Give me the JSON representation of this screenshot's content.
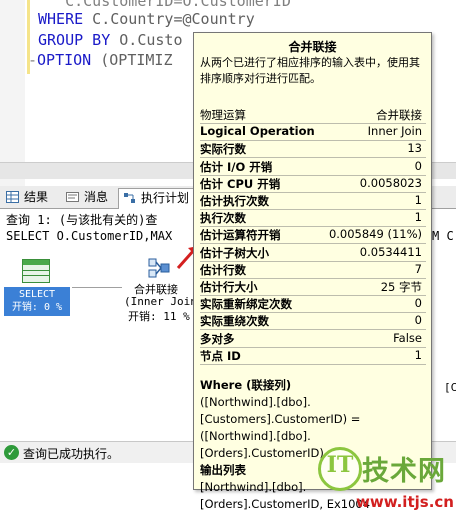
{
  "editor": {
    "lines": [
      {
        "kw": "WHERE",
        "rest": " C.Country=@Country"
      },
      {
        "kw": "GROUP BY",
        "rest": " O.Custo"
      },
      {
        "kw": "OPTION",
        "rest": " (OPTIMIZ"
      }
    ]
  },
  "tabs": [
    {
      "label": "结果"
    },
    {
      "label": "消息"
    },
    {
      "label": "执行计划"
    }
  ],
  "plan": {
    "query_header": "查询 1: (与该批有关的)查",
    "query_text": "SELECT O.CustomerID,MAX",
    "query_text_right": "M C",
    "select_node": {
      "label": "SELECT",
      "cost": "开销: 0 %"
    },
    "merge_node": {
      "label": "合并联接",
      "sub": "(Inner Join",
      "cost": "开销: 11 %"
    },
    "right_fragment": "[C"
  },
  "tooltip": {
    "title": "合并联接",
    "description": "从两个已进行了相应排序的输入表中，使用其排序顺序对行进行匹配。",
    "rows": [
      {
        "key": "物理运算",
        "value": "合并联接",
        "bold": false
      },
      {
        "key": "Logical Operation",
        "value": "Inner Join",
        "bold": true
      },
      {
        "key": "实际行数",
        "value": "13",
        "bold": true
      },
      {
        "key": "估计 I/O 开销",
        "value": "0",
        "bold": true
      },
      {
        "key": "估计 CPU 开销",
        "value": "0.0058023",
        "bold": true
      },
      {
        "key": "估计执行次数",
        "value": "1",
        "bold": true
      },
      {
        "key": "执行次数",
        "value": "1",
        "bold": true
      },
      {
        "key": "估计运算符开销",
        "value": "0.005849 (11%)",
        "bold": true
      },
      {
        "key": "估计子树大小",
        "value": "0.0534411",
        "bold": true
      },
      {
        "key": "估计行数",
        "value": "7",
        "bold": true
      },
      {
        "key": "估计行大小",
        "value": "25 字节",
        "bold": true
      },
      {
        "key": "实际重新绑定次数",
        "value": "0",
        "bold": true
      },
      {
        "key": "实际重绕次数",
        "value": "0",
        "bold": true
      },
      {
        "key": "多对多",
        "value": "False",
        "bold": true
      },
      {
        "key": "节点 ID",
        "value": "1",
        "bold": true
      }
    ],
    "where_title": "Where (联接列)",
    "where_lines": [
      "([Northwind].[dbo].",
      "[Customers].CustomerID) =",
      "([Northwind].[dbo].",
      "[Orders].CustomerID)"
    ],
    "output_title": "输出列表",
    "output_lines": [
      "[Northwind].[dbo].",
      "[Orders].CustomerID, Ex1004"
    ]
  },
  "status": {
    "text": "查询已成功执行。"
  },
  "watermark": {
    "logo": "IT",
    "brand": "技术网",
    "url": "www.itjs.cn"
  }
}
